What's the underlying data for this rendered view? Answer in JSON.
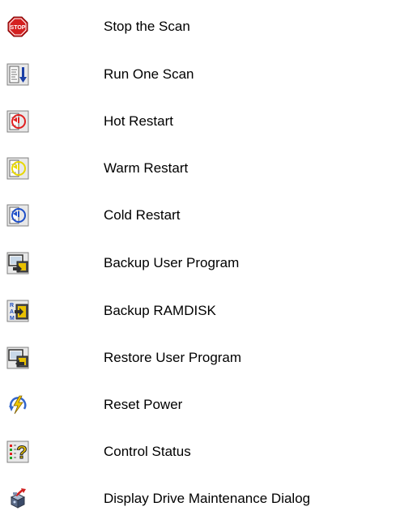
{
  "commands": [
    {
      "icon": "stop-sign-icon",
      "label": "Stop the Scan"
    },
    {
      "icon": "run-one-scan-icon",
      "label": "Run One Scan"
    },
    {
      "icon": "hot-restart-icon",
      "label": "Hot Restart"
    },
    {
      "icon": "warm-restart-icon",
      "label": "Warm Restart"
    },
    {
      "icon": "cold-restart-icon",
      "label": "Cold Restart"
    },
    {
      "icon": "backup-user-program-icon",
      "label": "Backup User Program"
    },
    {
      "icon": "backup-ramdisk-icon",
      "label": "Backup RAMDISK"
    },
    {
      "icon": "restore-user-program-icon",
      "label": "Restore User Program"
    },
    {
      "icon": "reset-power-icon",
      "label": "Reset Power"
    },
    {
      "icon": "control-status-icon",
      "label": "Control Status"
    },
    {
      "icon": "drive-maintenance-icon",
      "label": "Display Drive Maintenance Dialog"
    }
  ],
  "icon_text": {
    "stop": "STOP",
    "ram": "RAM"
  },
  "colors": {
    "stop_red": "#d42020",
    "down_arrow_blue": "#1a3fa6",
    "hot_red": "#e02020",
    "warm_yellow": "#e8d800",
    "cold_blue": "#1f4fc8",
    "folder_yellow": "#e8c000",
    "reset_blue": "#3366cc",
    "bolt_yellow": "#f0c800"
  }
}
